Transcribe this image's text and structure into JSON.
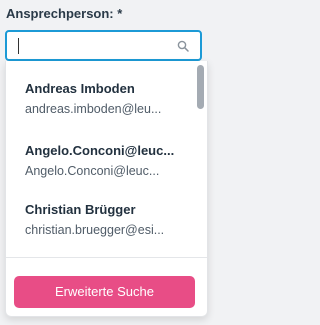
{
  "field": {
    "label": "Ansprechperson: *",
    "search_value": "",
    "search_icon": "search-icon"
  },
  "dropdown": {
    "items": [
      {
        "name": "Andreas Imboden",
        "email": "andreas.imboden@leu..."
      },
      {
        "name": "Angelo.Conconi@leuc...",
        "email": "Angelo.Conconi@leuc..."
      },
      {
        "name": "Christian Brügger",
        "email": "christian.bruegger@esi..."
      }
    ],
    "advanced_search_label": "Erweiterte Suche"
  },
  "colors": {
    "accent_border": "#1c9ad6",
    "button": "#e84d86",
    "label": "#2a3a48"
  }
}
